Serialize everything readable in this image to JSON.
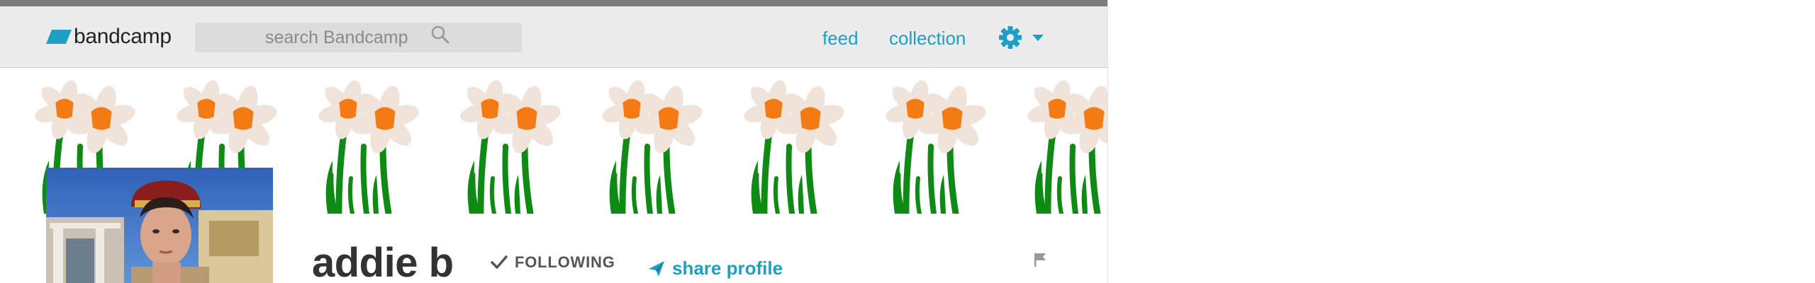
{
  "header": {
    "logo_text": "bandcamp",
    "search_placeholder": "search Bandcamp",
    "nav": [
      {
        "label": "feed"
      },
      {
        "label": "collection"
      }
    ],
    "settings_icon": "gear-icon"
  },
  "banner": {
    "pattern": "daffodils",
    "petal_color": "#efe3da",
    "trumpet_color": "#f47a14",
    "stem_color": "#0f8a14"
  },
  "profile": {
    "name": "addie b",
    "following_label": "FOLLOWING",
    "share_label": "share profile"
  },
  "colors": {
    "accent": "#1da0c3",
    "header_bg": "#ececec",
    "top_strip": "#7a7a7a",
    "logo_mark": "#1da0c3"
  }
}
